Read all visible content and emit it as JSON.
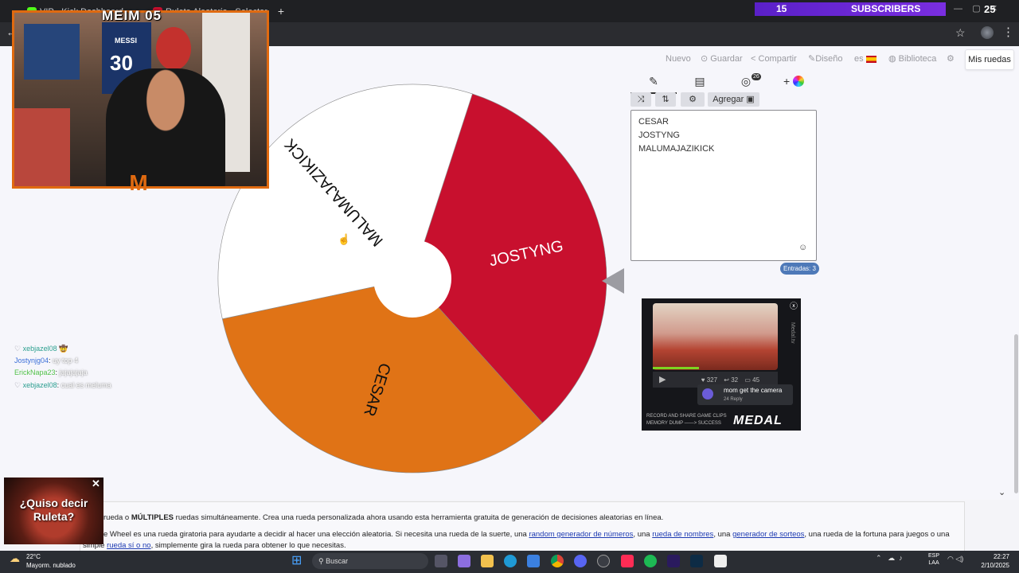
{
  "browser": {
    "tabs": [
      {
        "label": "VIP - Kick Dashboard",
        "color": "#53fc18"
      },
      {
        "label": "Ruleta Aleatoria - Selector",
        "color": "#c8102e"
      }
    ],
    "new_tab": "+"
  },
  "stream_overlay": {
    "subscribers_count": "15",
    "subscribers_label": "SUBSCRIBERS",
    "goal": "25",
    "cam_title": "MEIM 05",
    "jersey_name": "MESSI",
    "jersey_number": "30"
  },
  "toolbar": {
    "nuevo": "Nuevo",
    "guardar": "Guardar",
    "compartir": "Compartir",
    "diseno": "Diseño",
    "lang": "es",
    "biblioteca": "Biblioteca",
    "mis_ruedas": "Mis ruedas"
  },
  "wheel": {
    "segments": [
      {
        "label": "JOSTYNG",
        "color": "#c8102e",
        "text_color": "#ffffff"
      },
      {
        "label": "CESAR",
        "color": "#e07316",
        "text_color": "#111111"
      },
      {
        "label": "MALUMAJAZIKICK",
        "color": "#ffffff",
        "text_color": "#111111"
      }
    ]
  },
  "editor": {
    "badge": "26",
    "add_image_label": "Agregar",
    "entries": [
      "CESAR",
      "JOSTYNG",
      "MALUMAJAZIKICK"
    ],
    "entries_count": "Entradas: 3"
  },
  "ad": {
    "stats": [
      "327",
      "32",
      "45"
    ],
    "comment": "mom get the camera",
    "comment_meta": "24   Reply",
    "tag1": "RECORD AND SHARE GAME CLIPS",
    "tag2": "MEMORY DUMP ——> SUCCESS",
    "logo": "MEDAL",
    "side": "Medal.tv"
  },
  "chat": [
    {
      "user": "xebjazel08",
      "msg": "",
      "color": "#2a9d8f"
    },
    {
      "user": "Jostynjg04",
      "msg": "uy top 4",
      "color": "#3b6fd8"
    },
    {
      "user": "ErickNapa23",
      "msg": "jajajajaja",
      "color": "#53c24a"
    },
    {
      "user": "xebjazel08",
      "msg": "cual es meluma",
      "color": "#2a9d8f"
    }
  ],
  "content": {
    "line1_pre": "rueda o",
    "line1_bold": "MÚLTIPLES",
    "line1_post": "ruedas simultáneamente. Crea una rueda personalizada ahora usando esta herramienta gratuita de generación de decisiones aleatorias en línea.",
    "line2_pre": "e Wheel es una rueda giratoria para ayudarte a decidir al hacer una elección aleatoria. Si necesita una rueda de la suerte, una",
    "link1": "random generador de números",
    "sep1": ", una",
    "link2": "rueda de nombres",
    "sep2": ", una",
    "link3": "generador de sorteos",
    "line2_post": ", una rueda de la fortuna para juegos o una",
    "line3_pre": "simple",
    "link4": "rueda sí o no",
    "line3_post": ", simplemente gira la rueda para obtener lo que necesitas."
  },
  "promo": {
    "text": "¿Quiso decir Ruleta?",
    "close": "✕"
  },
  "taskbar": {
    "temp": "22°C",
    "weather": "Mayorm. nublado",
    "search": "Buscar",
    "lang_top": "ESP",
    "lang_bottom": "LAA",
    "time": "22:27",
    "date": "2/10/2025"
  }
}
